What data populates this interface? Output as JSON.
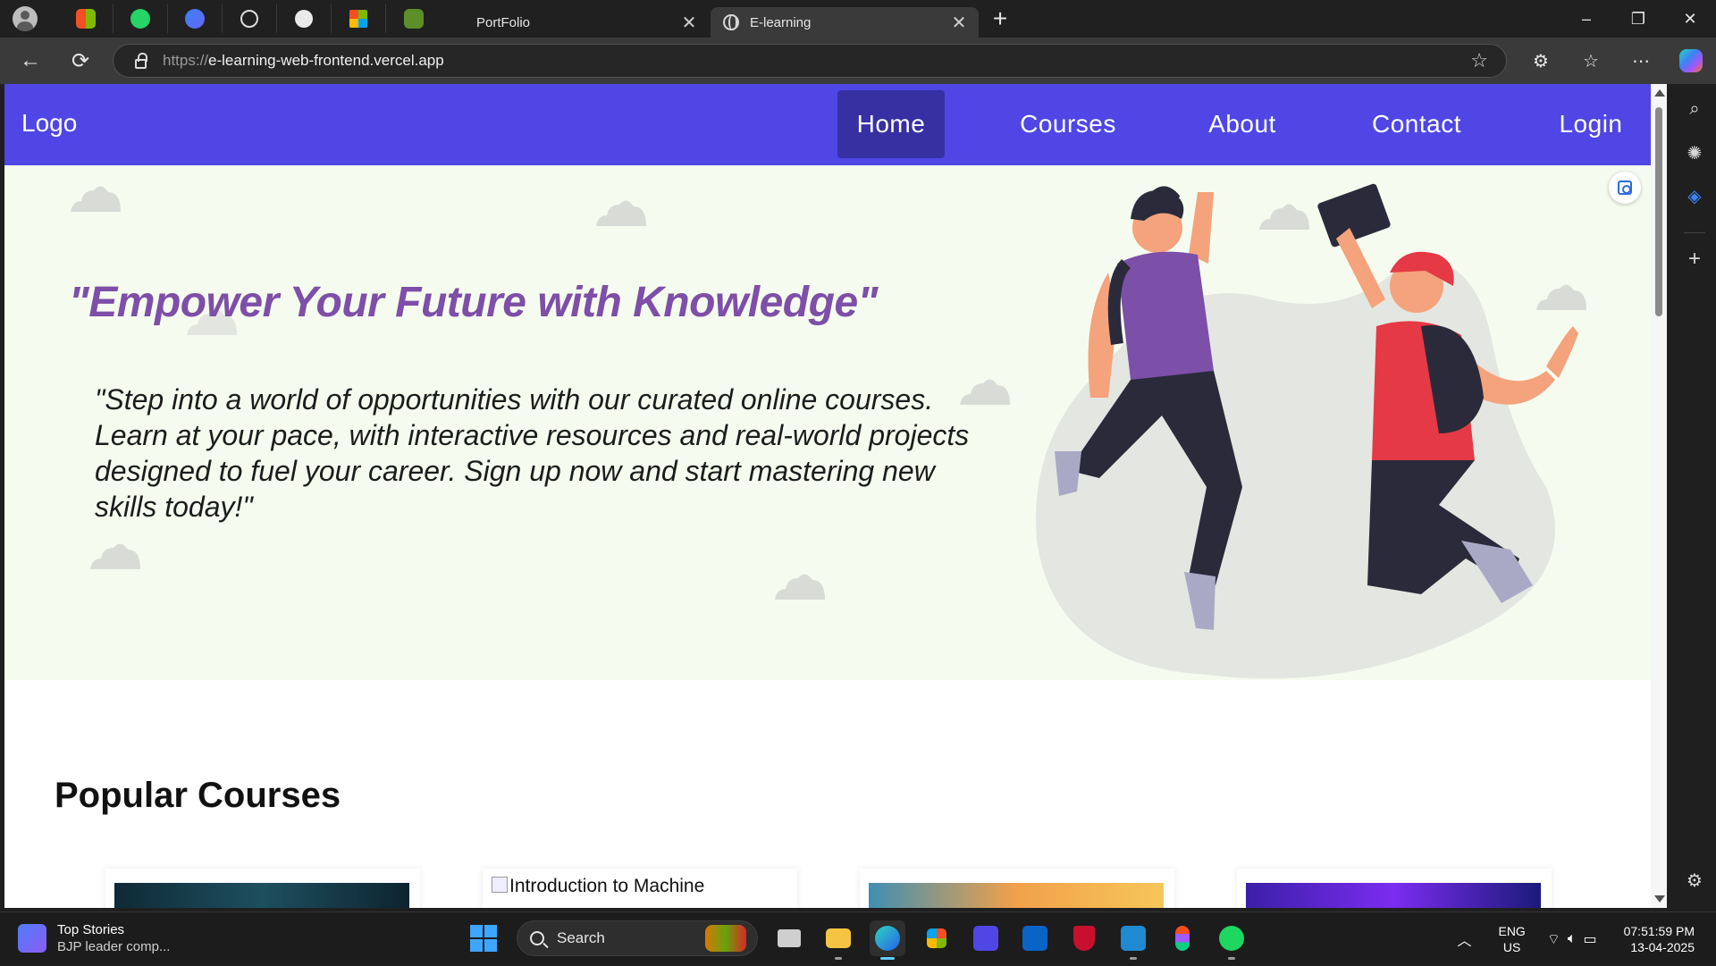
{
  "browser": {
    "tabs": [
      {
        "title": "PortFolio",
        "active": false
      },
      {
        "title": "E-learning",
        "active": true
      }
    ],
    "pinned_tabs": [
      "microsoft-store-icon",
      "whatsapp-icon",
      "copilot-app-icon",
      "globe-icon",
      "github-icon",
      "microsoft-icon",
      "game-icon"
    ],
    "address": {
      "scheme": "https://",
      "host": "e-learning-web-frontend.vercel.app"
    },
    "window_controls": {
      "minimize": "–",
      "restore": "❐",
      "close": "✕"
    }
  },
  "site": {
    "brand": "Logo",
    "nav": [
      {
        "label": "Home",
        "active": true
      },
      {
        "label": "Courses",
        "active": false
      },
      {
        "label": "About",
        "active": false
      },
      {
        "label": "Contact",
        "active": false
      },
      {
        "label": "Login",
        "active": false
      }
    ],
    "hero": {
      "heading": "\"Empower Your Future with Knowledge\"",
      "text": "\"Step into a world of opportunities with our curated online courses. Learn at your pace, with interactive resources and real-world projects designed to fuel your career. Sign up now and start mastering new skills today!\""
    },
    "popular": {
      "title": "Popular Courses",
      "cards": [
        {
          "image_alt": ""
        },
        {
          "image_alt": "Introduction to Machine"
        },
        {
          "image_alt": ""
        },
        {
          "image_alt": ""
        }
      ]
    }
  },
  "taskbar": {
    "news": {
      "title": "Top Stories",
      "subtitle": "BJP leader comp..."
    },
    "search_label": "Search",
    "language": {
      "lang": "ENG",
      "region": "US"
    },
    "time": "07:51:59 PM",
    "date": "13-04-2025"
  },
  "colors": {
    "nav_bg": "#4f46e5",
    "nav_active": "#3730a3",
    "hero_bg": "#f5fcef",
    "heading": "#7e4ea8"
  }
}
